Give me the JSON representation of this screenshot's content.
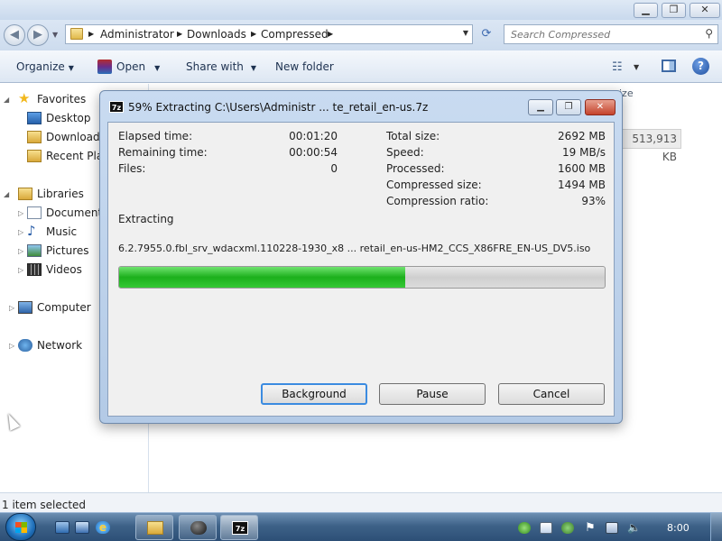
{
  "explorer": {
    "window_controls": {
      "minimize": "▁",
      "maximize": "❐",
      "close": "✕"
    },
    "breadcrumb": [
      "Administrator",
      "Downloads",
      "Compressed"
    ],
    "search_placeholder": "Search Compressed",
    "toolbar": {
      "organize": "Organize",
      "open": "Open",
      "share_with": "Share with",
      "new_folder": "New folder"
    },
    "nav": {
      "favorites": "Favorites",
      "desktop": "Desktop",
      "downloads": "Downloads",
      "recent_places": "Recent Plac",
      "libraries": "Libraries",
      "documents": "Documents",
      "music": "Music",
      "pictures": "Pictures",
      "videos": "Videos",
      "computer": "Computer",
      "network": "Network"
    },
    "columns": {
      "size": "ize"
    },
    "file_size": "513,913 KB",
    "status": "1 item selected"
  },
  "dialog": {
    "title": "59% Extracting C:\\Users\\Administr ... te_retail_en-us.7z",
    "app_icon": "7z",
    "stats_left": [
      {
        "label": "Elapsed time:",
        "value": "00:01:20"
      },
      {
        "label": "Remaining time:",
        "value": "00:00:54"
      },
      {
        "label": "Files:",
        "value": "0"
      }
    ],
    "stats_right": [
      {
        "label": "Total size:",
        "value": "2692 MB"
      },
      {
        "label": "Speed:",
        "value": "19 MB/s"
      },
      {
        "label": "Processed:",
        "value": "1600 MB"
      },
      {
        "label": "Compressed size:",
        "value": "1494 MB"
      },
      {
        "label": "Compression ratio:",
        "value": "93%"
      }
    ],
    "status": "Extracting",
    "current_file": "6.2.7955.0.fbl_srv_wdacxml.110228-1930_x8 ... retail_en-us-HM2_CCS_X86FRE_EN-US_DV5.iso",
    "progress": 59,
    "buttons": {
      "background": "Background",
      "pause": "Pause",
      "cancel": "Cancel"
    }
  },
  "taskbar": {
    "clock": "8:00",
    "tasks": [
      "windows-explorer",
      "media-player",
      "7-zip"
    ]
  },
  "colors": {
    "progress": "#1cb01c",
    "accent": "#3b8be0",
    "taskbar": "#3e6288"
  }
}
